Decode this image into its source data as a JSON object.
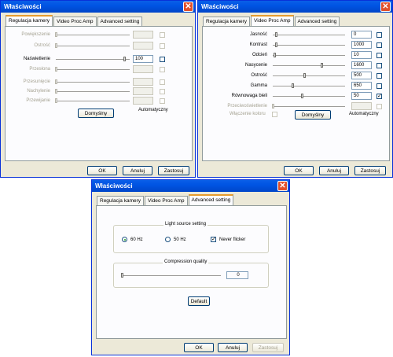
{
  "window1": {
    "title": "Właściwości",
    "tabs": [
      "Regulacja kamery",
      "Video Proc Amp",
      "Advanced setting"
    ],
    "rows": [
      {
        "label": "Powiększenie",
        "value": "",
        "enabled": false
      },
      {
        "label": "Ostrość",
        "value": "",
        "enabled": false
      },
      {
        "label": "Naświetlenie",
        "value": "100",
        "enabled": true
      },
      {
        "label": "Przesłona",
        "value": "",
        "enabled": false
      },
      {
        "label": "Przesunięcie",
        "value": "",
        "enabled": false
      },
      {
        "label": "Nachylenie",
        "value": "",
        "enabled": false
      },
      {
        "label": "Przewijanie",
        "value": "",
        "enabled": false
      }
    ],
    "default_label": "Domyślny",
    "auto_label": "Automatyczny",
    "ok": "OK",
    "cancel": "Anuluj",
    "apply": "Zastosuj"
  },
  "window2": {
    "title": "Właściwości",
    "tabs": [
      "Regulacja kamery",
      "Video Proc Amp",
      "Advanced setting"
    ],
    "rows": [
      {
        "label": "Jasność",
        "value": "0",
        "enabled": true,
        "level": 0.05,
        "auto": false
      },
      {
        "label": "Kontrast",
        "value": "1000",
        "enabled": true,
        "level": 0.05,
        "auto": false
      },
      {
        "label": "Odcień",
        "value": "10",
        "enabled": true,
        "level": 0.02,
        "auto": false
      },
      {
        "label": "Nasycenie",
        "value": "1600",
        "enabled": true,
        "level": 0.7,
        "auto": false
      },
      {
        "label": "Ostrość",
        "value": "500",
        "enabled": true,
        "level": 0.45,
        "auto": false
      },
      {
        "label": "Gamma",
        "value": "650",
        "enabled": true,
        "level": 0.28,
        "auto": false
      },
      {
        "label": "Równowaga bieli",
        "value": "50",
        "enabled": true,
        "level": 0.42,
        "auto": true
      },
      {
        "label": "Przeciwoświetlenie",
        "value": "",
        "enabled": false,
        "level": 0.0,
        "auto": false
      }
    ],
    "color_enable_label": "Włączenie koloru",
    "default_label": "Domyślny",
    "auto_label": "Automatyczny",
    "ok": "OK",
    "cancel": "Anuluj",
    "apply": "Zastosuj"
  },
  "window3": {
    "title": "Właściwości",
    "tabs": [
      "Regulacja kamery",
      "Video Proc Amp",
      "Advanced setting"
    ],
    "light_source_label": "Light source setting",
    "radio_60": "60 Hz",
    "radio_50": "50 Hz",
    "never_flicker": "Never flicker",
    "compression_label": "Compression quality",
    "compression_value": "0",
    "default_label": "Default",
    "ok": "OK",
    "cancel": "Anuluj",
    "apply": "Zastosuj"
  }
}
